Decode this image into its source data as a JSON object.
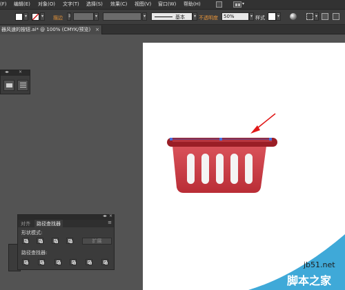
{
  "menu": {
    "items": [
      {
        "label": "(F)"
      },
      {
        "label": "编辑(E)"
      },
      {
        "label": "对象(O)"
      },
      {
        "label": "文字(T)"
      },
      {
        "label": "选择(S)"
      },
      {
        "label": "效果(C)"
      },
      {
        "label": "视图(V)"
      },
      {
        "label": "窗口(W)"
      },
      {
        "label": "帮助(H)"
      }
    ]
  },
  "control": {
    "stroke_label": "描边",
    "brush_label": "基本",
    "opacity_label": "不透明度",
    "opacity_value": "50%",
    "style_label": "样式"
  },
  "document": {
    "tab_title": "器风速的按钮.ai* @ 100% (CMYK/预览)",
    "close_glyph": "×"
  },
  "pathfinder": {
    "tab_align": "对齐",
    "tab_pathfinder": "路径查找器",
    "shape_modes_label": "形状模式:",
    "expand_label": "扩展",
    "pathfinders_label": "路径查找器:",
    "menu_glyph": "≡"
  },
  "watermark": {
    "line1": "jb51.net",
    "line2": "脚本之家"
  },
  "colors": {
    "menubar": "#323232",
    "control_bar": "#3c3c3c",
    "workspace": "#535353",
    "accent_label": "#e8953a",
    "basket_red": "#c2343c",
    "arrow_red": "#e01818"
  }
}
